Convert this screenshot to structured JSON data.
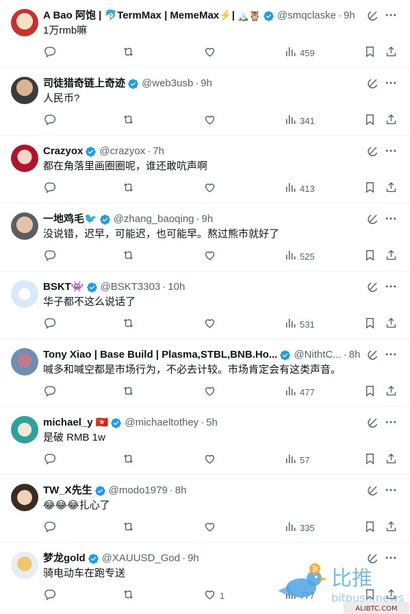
{
  "colors": {
    "text": "#0f1419",
    "muted": "#536471",
    "verified": "#1d9bf0",
    "divider": "#eff3f4"
  },
  "tweets": [
    {
      "name": "A Bao 阿饱 | 🐬TermMax | MemeMax⚡️|",
      "emoji": "🏔️🦉",
      "handle": "@smqclaske",
      "time": "9h",
      "text": "1万rmb嘛",
      "views": "459",
      "likes": ""
    },
    {
      "name": "司徒猎奇链上奇迹",
      "emoji": "",
      "handle": "@web3usb",
      "time": "9h",
      "text": "人民币?",
      "views": "341",
      "likes": ""
    },
    {
      "name": "Crazyox",
      "emoji": "",
      "handle": "@crazyox",
      "time": "7h",
      "text": "都在角落里画圈圈呢，谁还敢吭声啊",
      "views": "413",
      "likes": ""
    },
    {
      "name": "一地鸡毛🐦",
      "emoji": "",
      "handle": "@zhang_baoqing",
      "time": "9h",
      "text": "没说错，迟早，可能迟，也可能早。熬过熊市就好了",
      "views": "525",
      "likes": ""
    },
    {
      "name": "BSKT👾",
      "emoji": "",
      "handle": "@BSKT3303",
      "time": "10h",
      "text": "华子都不这么说话了",
      "views": "531",
      "likes": ""
    },
    {
      "name": "Tony Xiao | Base Build | Plasma,STBL,BNB.Ho...",
      "emoji": "",
      "handle": "@NithtC...",
      "time": "8h",
      "text": "喊多和喊空都是市场行为，不必去计较。市场肯定会有这类声音。",
      "views": "477",
      "likes": ""
    },
    {
      "name": "michael_y 🇭🇰",
      "emoji": "",
      "handle": "@michaeltothey",
      "time": "5h",
      "text": "是破 RMB 1w",
      "views": "57",
      "likes": ""
    },
    {
      "name": "TW_X先生",
      "emoji": "",
      "handle": "@modo1979",
      "time": "8h",
      "text": "😂😂😂扎心了",
      "views": "335",
      "likes": ""
    },
    {
      "name": "梦龙gold",
      "emoji": "",
      "handle": "@XAUUSD_God",
      "time": "9h",
      "text": "骑电动车在跑专送",
      "views": "777",
      "likes": "1"
    }
  ],
  "watermark": {
    "brand": "比推",
    "site": "bitpush.news",
    "site2": "ALIBTC.COM"
  }
}
